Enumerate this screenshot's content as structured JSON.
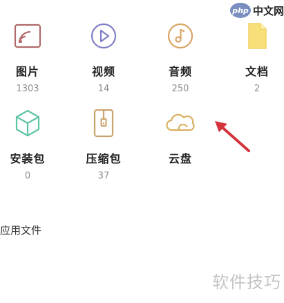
{
  "watermark": {
    "site_logo": "php",
    "site_name": "中文网",
    "bottom_text": "软件技巧"
  },
  "categories": [
    {
      "label": "图片",
      "count": "1303",
      "icon": "image-icon",
      "color": "#b06a6a"
    },
    {
      "label": "视频",
      "count": "14",
      "icon": "video-play-icon",
      "color": "#7f7fc4"
    },
    {
      "label": "音频",
      "count": "250",
      "icon": "music-note-icon",
      "color": "#d9a464"
    },
    {
      "label": "文档",
      "count": "2",
      "icon": "document-icon",
      "color": "#f2d263"
    },
    {
      "label": "安装包",
      "count": "0",
      "icon": "package-cube-icon",
      "color": "#5fc4a6"
    },
    {
      "label": "压缩包",
      "count": "37",
      "icon": "zip-archive-icon",
      "color": "#c8a36b"
    },
    {
      "label": "云盘",
      "count": "",
      "icon": "cloud-icon",
      "color": "#d9b062"
    }
  ],
  "section": {
    "title": "应用文件"
  },
  "annotation": {
    "arrow_color": "#d4343c"
  }
}
